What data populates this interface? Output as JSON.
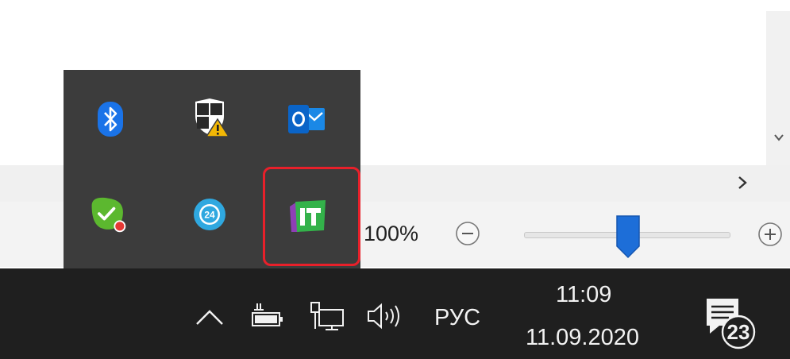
{
  "statusbar": {
    "zoom_percent": "100%",
    "zoom_level": 0.5
  },
  "tray_popup": {
    "icons": [
      {
        "name": "bluetooth-icon",
        "color": "#1a73e8"
      },
      {
        "name": "windows-security-warning-icon",
        "color": "#ffffff"
      },
      {
        "name": "outlook-icon",
        "color": "#0a64c8"
      },
      {
        "name": "green-check-app-icon",
        "color": "#5cb82f"
      },
      {
        "name": "bitrix24-icon",
        "color": "#2fa8e0"
      },
      {
        "name": "it-app-icon",
        "color": "#33b24a"
      }
    ],
    "highlight_color": "#e8202a"
  },
  "taskbar": {
    "language": "РУС",
    "time": "11:09",
    "date": "11.09.2020",
    "notification_count": "23"
  },
  "colors": {
    "taskbar_bg": "#1f1f1f",
    "popup_bg": "#3c3c3c",
    "slider_thumb": "#1d6ed8"
  }
}
